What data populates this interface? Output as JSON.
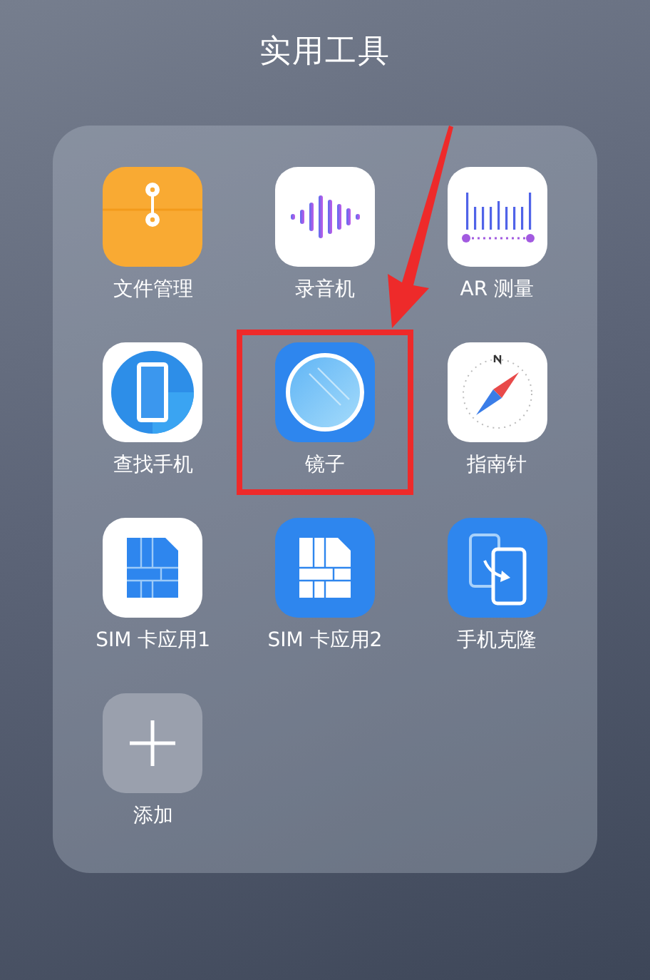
{
  "folder": {
    "title": "实用工具",
    "items": [
      {
        "kind": "files",
        "label": "文件管理",
        "highlighted": false
      },
      {
        "kind": "recorder",
        "label": "录音机",
        "highlighted": false
      },
      {
        "kind": "ar-measure",
        "label": "AR 测量",
        "highlighted": false
      },
      {
        "kind": "find-phone",
        "label": "查找手机",
        "highlighted": false
      },
      {
        "kind": "mirror",
        "label": "镜子",
        "highlighted": true
      },
      {
        "kind": "compass",
        "label": "指南针",
        "highlighted": false
      },
      {
        "kind": "sim-white",
        "label": "SIM 卡应用1",
        "highlighted": false
      },
      {
        "kind": "sim-blue",
        "label": "SIM 卡应用2",
        "highlighted": false
      },
      {
        "kind": "phone-clone",
        "label": "手机克隆",
        "highlighted": false
      },
      {
        "kind": "add",
        "label": "添加",
        "highlighted": false
      }
    ]
  }
}
